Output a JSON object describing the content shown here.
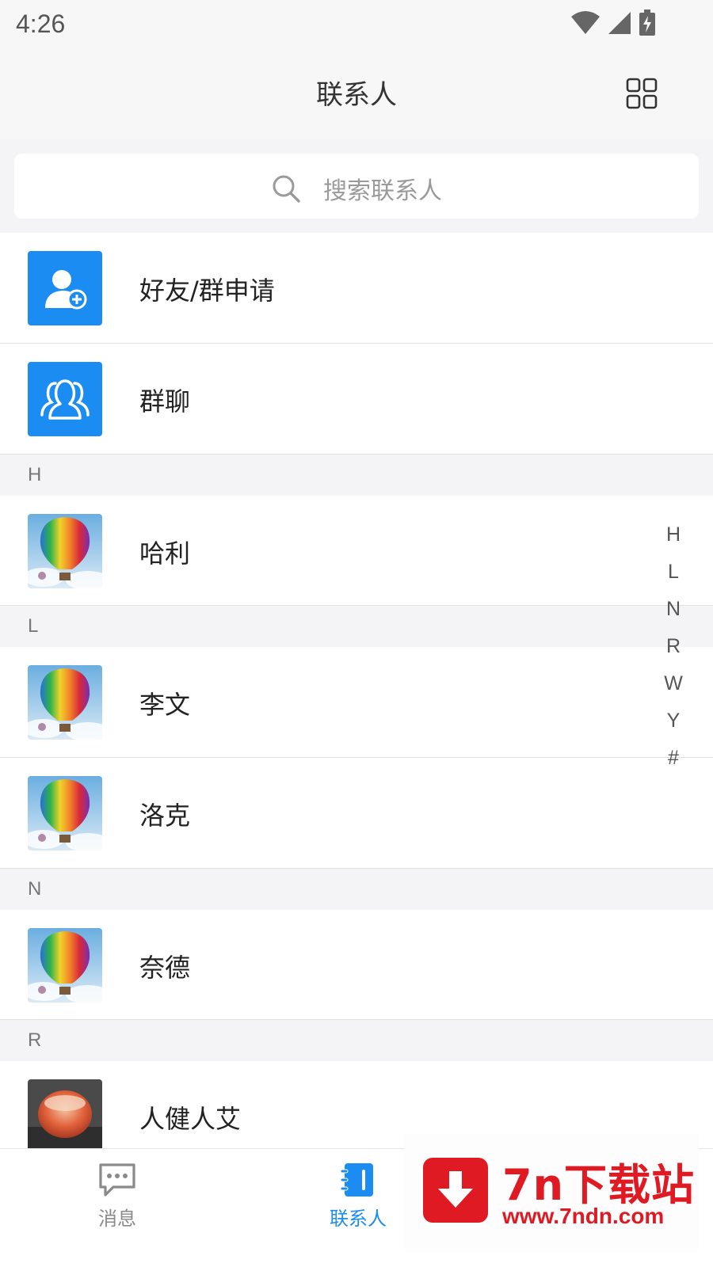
{
  "status_bar": {
    "time": "4:26"
  },
  "app_bar": {
    "title": "联系人",
    "grid_icon": "grid-icon"
  },
  "search": {
    "placeholder": "搜索联系人",
    "icon": "search-icon"
  },
  "fixed_items": [
    {
      "label": "好友/群申请",
      "icon": "add-friend-icon"
    },
    {
      "label": "群聊",
      "icon": "group-chat-icon"
    }
  ],
  "sections": [
    {
      "letter": "H",
      "contacts": [
        {
          "name": "哈利",
          "avatar": "balloon"
        }
      ]
    },
    {
      "letter": "L",
      "contacts": [
        {
          "name": "李文",
          "avatar": "balloon"
        },
        {
          "name": "洛克",
          "avatar": "balloon"
        }
      ]
    },
    {
      "letter": "N",
      "contacts": [
        {
          "name": "奈德",
          "avatar": "balloon"
        }
      ]
    },
    {
      "letter": "R",
      "contacts": [
        {
          "name": "人健人艾",
          "avatar": "photo-bowl"
        }
      ]
    }
  ],
  "index_letters": [
    "H",
    "L",
    "N",
    "R",
    "W",
    "Y",
    "#"
  ],
  "tabs": [
    {
      "label": "消息",
      "icon": "message-icon",
      "active": false
    },
    {
      "label": "联系人",
      "icon": "contacts-icon",
      "active": true
    }
  ],
  "watermark": {
    "title": "7n下载站",
    "url": "www.7ndn.com"
  },
  "colors": {
    "accent": "#1a8cf2",
    "background": "#f4f4f6",
    "watermark": "#e01a22"
  }
}
